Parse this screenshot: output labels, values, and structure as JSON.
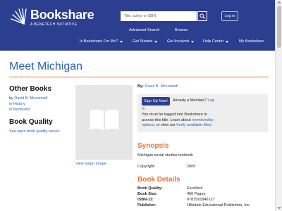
{
  "header": {
    "brand": "Bookshare",
    "tagline": "A BENETECH INITIATIVE",
    "search_placeholder": "Title, author or ISBN",
    "login_label": "Log in",
    "subnav": [
      "Advanced Search",
      "Browse"
    ],
    "nav": [
      "Is Bookshare For Me?",
      "Get Started",
      "Get Involved",
      "Help Center",
      "My Bookshare"
    ],
    "colors": {
      "primary": "#2c3e8f",
      "accent": "#e8732c",
      "link": "#2c63b5"
    }
  },
  "page": {
    "title": "Meet Michigan"
  },
  "sidebar": {
    "other_books_heading": "Other Books",
    "by_prefix": "by",
    "author_link": "David B. Mcconnell",
    "links": [
      "in History",
      "in Nonfiction"
    ],
    "quality_heading": "Book Quality",
    "quality_link": "See open book quality issues"
  },
  "cover": {
    "icon": "open-book-icon",
    "view_larger": "View larger image"
  },
  "book": {
    "by_label": "By:",
    "author": "David B. Mcconnell",
    "signup_label": "Sign Up Now!",
    "already_member": "Already a Member?",
    "log_link_1": "Log",
    "log_link_2": "In",
    "must_text_1": "You must be logged into Bookshare to access this title. Learn about",
    "membership_link": "membership options",
    "must_text_2": ", or view our",
    "freely_link": "freely available titles",
    "must_text_3": ".",
    "synopsis_heading": "Synopsis",
    "synopsis": "Michigan social studies textbook",
    "copyright_label": "Copyright:",
    "copyright_value": "2009",
    "details_heading": "Book Details",
    "details": [
      {
        "label": "Book Quality:",
        "value": "Excellent"
      },
      {
        "label": "Book Size:",
        "value": "456 Pages"
      },
      {
        "label": "ISBN-13:",
        "value": "9781591846127"
      },
      {
        "label": "Publisher:",
        "value": "Hillsdale Educational Publishers, Inc."
      }
    ]
  }
}
